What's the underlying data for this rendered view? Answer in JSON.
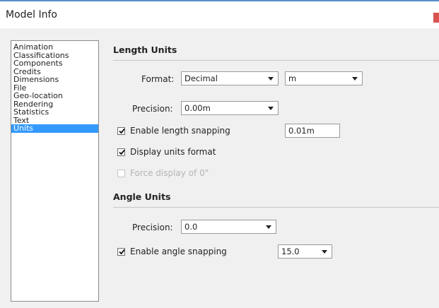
{
  "window": {
    "title": "Model Info"
  },
  "sidebar": {
    "items": [
      {
        "label": "Animation"
      },
      {
        "label": "Classifications"
      },
      {
        "label": "Components"
      },
      {
        "label": "Credits"
      },
      {
        "label": "Dimensions"
      },
      {
        "label": "File"
      },
      {
        "label": "Geo-location"
      },
      {
        "label": "Rendering"
      },
      {
        "label": "Statistics"
      },
      {
        "label": "Text"
      },
      {
        "label": "Units",
        "selected": true
      }
    ]
  },
  "length_units": {
    "title": "Length Units",
    "format_label": "Format:",
    "format_value": "Decimal",
    "unit_value": "m",
    "precision_label": "Precision:",
    "precision_value": "0.00m",
    "enable_snapping_label": "Enable length snapping",
    "enable_snapping_checked": true,
    "snapping_value": "0.01m",
    "display_units_label": "Display units format",
    "display_units_checked": true,
    "force_display_label": "Force display of 0\"",
    "force_display_checked": false,
    "force_display_enabled": false
  },
  "angle_units": {
    "title": "Angle Units",
    "precision_label": "Precision:",
    "precision_value": "0.0",
    "enable_snapping_label": "Enable angle snapping",
    "enable_snapping_checked": true,
    "snapping_value": "15.0"
  },
  "icons": {
    "checkmark": "checkmark-icon",
    "dropdown": "dropdown-arrow-icon"
  },
  "colors": {
    "selection": "#3399ff",
    "title_accent": "#5b8ec9",
    "close": "#d9534f"
  }
}
